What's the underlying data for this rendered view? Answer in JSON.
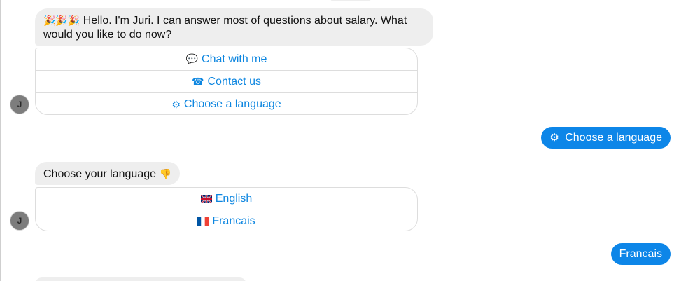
{
  "messages": {
    "bot_intro": {
      "emojis": "🎉🎉🎉",
      "text": "Hello. I'm Juri. I can answer most of questions about salary. What would you like to do now?"
    },
    "intro_options": [
      {
        "icon": "💬",
        "label": "Chat with me"
      },
      {
        "icon": "☎",
        "label": "Contact us"
      },
      {
        "icon": "⚙",
        "label": "Choose a language"
      }
    ],
    "user_reply_1": {
      "icon": "⚙",
      "label": "Choose a language"
    },
    "bot_language_prompt": {
      "text": "Choose your language",
      "emoji": "👎"
    },
    "language_options": [
      {
        "flag": "uk-flag",
        "label": "English"
      },
      {
        "flag": "fr-flag",
        "label": "Francais"
      }
    ],
    "user_reply_2": {
      "label": "Francais"
    }
  },
  "avatar": {
    "initial": "J"
  },
  "colors": {
    "accent": "#0d86e8",
    "bot_bubble": "#eeeeee",
    "link": "#0d86e0"
  }
}
